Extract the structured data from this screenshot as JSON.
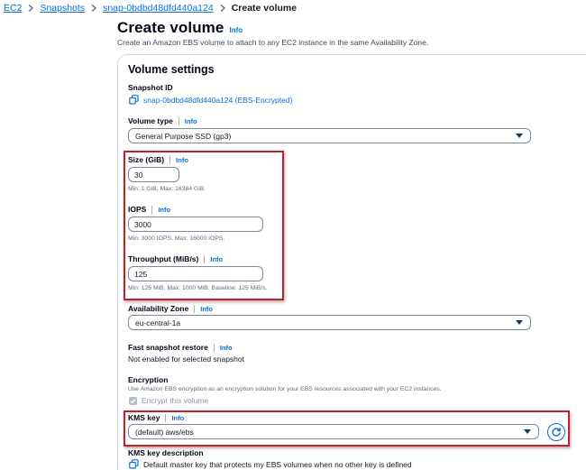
{
  "breadcrumb": {
    "items": [
      "EC2",
      "Snapshots",
      "snap-0bdbd48dfd440a124"
    ],
    "current": "Create volume"
  },
  "header": {
    "title": "Create volume",
    "info": "Info",
    "description": "Create an Amazon EBS volume to attach to any EC2 instance in the same Availability Zone."
  },
  "volume_settings": {
    "title": "Volume settings",
    "snapshot_id": {
      "label": "Snapshot ID",
      "value": "snap-0bdbd48dfd440a124 (EBS-Encrypted)"
    },
    "volume_type": {
      "label": "Volume type",
      "info": "Info",
      "value": "General Purpose SSD (gp3)"
    },
    "size": {
      "label": "Size (GiB)",
      "info": "Info",
      "value": "30",
      "hint": "Min: 1 GiB, Max: 16384 GiB."
    },
    "iops": {
      "label": "IOPS",
      "info": "Info",
      "value": "3000",
      "hint": "Min: 3000 IOPS, Max: 16000 IOPS."
    },
    "throughput": {
      "label": "Throughput (MiB/s)",
      "info": "Info",
      "value": "125",
      "hint": "Min: 125 MiB, Max: 1000 MiB. Baseline: 125 MiB/s."
    },
    "availability_zone": {
      "label": "Availability Zone",
      "info": "Info",
      "value": "eu-central-1a"
    },
    "fast_snapshot_restore": {
      "label": "Fast snapshot restore",
      "info": "Info",
      "value": "Not enabled for selected snapshot"
    },
    "encryption": {
      "label": "Encryption",
      "description": "Use Amazon EBS encryption as an encryption solution for your EBS resources associated with your EC2 instances.",
      "checkbox_label": "Encrypt this volume",
      "checked": true
    },
    "kms_key": {
      "label": "KMS key",
      "info": "Info",
      "value": "(default) aws/ebs"
    },
    "kms_key_description": {
      "label": "KMS key description",
      "value": "Default master key that protects my EBS volumes when no other key is defined"
    }
  },
  "colors": {
    "link": "#0972d3",
    "highlight_box": "#c0222c",
    "text": "#16191f"
  }
}
